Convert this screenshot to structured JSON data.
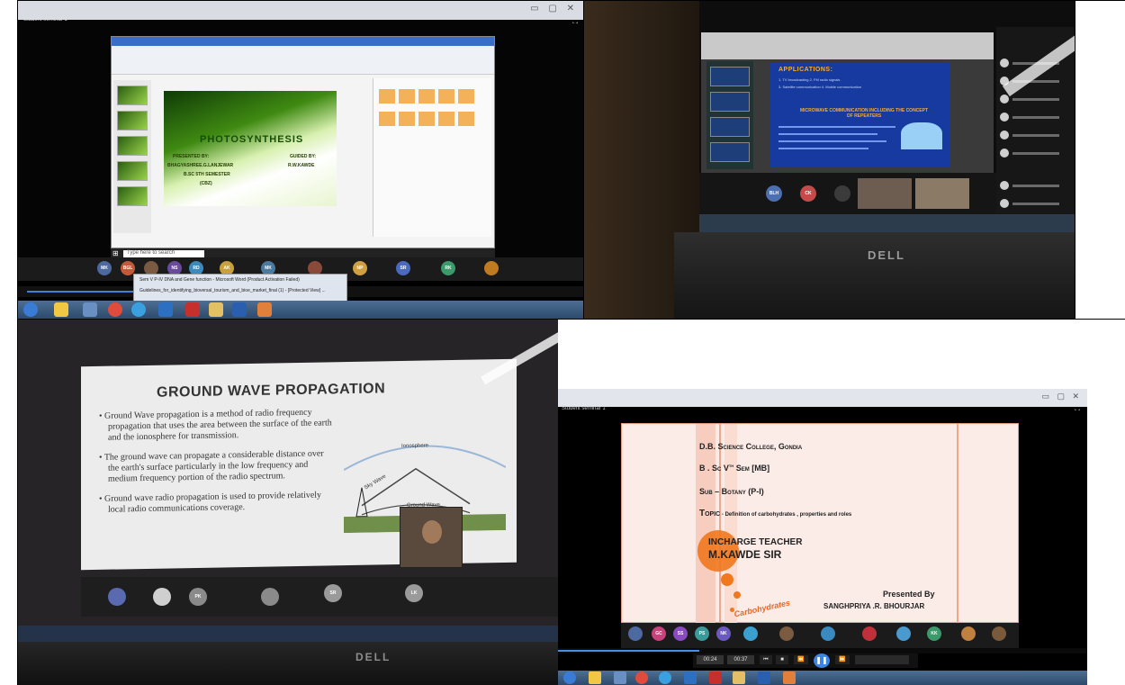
{
  "panel_top_left": {
    "window_label": "Student seminar 1",
    "slide": {
      "title": "PHOTOSYNTHESIS",
      "presented_by_label": "PRESENTED BY:",
      "presenter_name": "BHAGYASHREE.G.LANJEWAR",
      "class_line": "B.SC 5TH SEMESTER",
      "group": "(CBZ)",
      "guided_by_label": "GUIDED BY:",
      "guide_name": "R.W.KAWDE"
    },
    "search_placeholder": "Type here to search",
    "participant_initials": [
      "MK",
      "BGL",
      "",
      "NS",
      "RD",
      "AK",
      "MK",
      "",
      "",
      "NP",
      "SR",
      "",
      "RK",
      ""
    ],
    "popup_items": [
      "Sem V P-IV DNA and Gene function - Microsoft Word (Product Activation Failed)",
      "Guidelines_for_identifying_bioversal_tourism_and_bioe_market_final (1) - [Protected View] ..."
    ]
  },
  "panel_top_right": {
    "slide": {
      "heading": "APPLICATIONS:",
      "subheading": "MICROWAVE COMMUNICATION INCLUDING THE CONCEPT OF REPEATERS",
      "bullets": [
        "1. TV broadcasting  2. FM radio signals",
        "3. Satellite communication  4. Mobile communication"
      ]
    },
    "participant_initials": [
      "BLH",
      "CK"
    ],
    "brand": "DELL"
  },
  "panel_bottom_left": {
    "slide": {
      "title": "GROUND WAVE PROPAGATION",
      "bullets": [
        "Ground Wave propagation is a method of radio frequency propagation that uses the area between the surface of the earth and the ionosphere for transmission.",
        "The ground wave can propagate a considerable distance over the earth's surface particularly in the low frequency and medium frequency portion of the radio spectrum.",
        "Ground wave radio propagation is used to provide relatively local radio communications coverage."
      ],
      "diagram_labels": [
        "Ionosphere",
        "Sky Wave",
        "Ground Wave"
      ]
    },
    "participant_initials": [
      "",
      "",
      "PK",
      "",
      "SR",
      "LK"
    ],
    "brand": "DELL"
  },
  "panel_bottom_right": {
    "window_label": "Student seminar 1",
    "slide": {
      "college": "D.B. Science College, Gondia",
      "class_prefix": "B . Sc V",
      "class_sup": "th",
      "class_suffix": " Sem [MB]",
      "subject": "Sub – Botany (P-I)",
      "topic_label": "Topic",
      "topic": " - Definition of carbohydrates , properties and roles",
      "incharge_label": "INCHARGE TEACHER",
      "incharge_name": "M.KAWDE SIR",
      "presented_by_label": "Presented By",
      "presenter_name": "SANGHPRIYA .R. BHOURJAR",
      "watermark": "Carbohydrates"
    },
    "participant_initials": [
      "",
      "GC",
      "SS",
      "PS",
      "NK",
      "",
      "",
      "",
      "SD",
      "",
      "",
      "",
      "KK",
      "",
      ""
    ],
    "time_left": "00:24",
    "time_right": "00:37"
  },
  "colors": {
    "win_taskbar": "#3d5f83",
    "zoom_blue": "#3b86e4",
    "slide_green": "#3f8a12",
    "slide_blue": "#163aa0",
    "slide_orange": "#f0781e"
  }
}
